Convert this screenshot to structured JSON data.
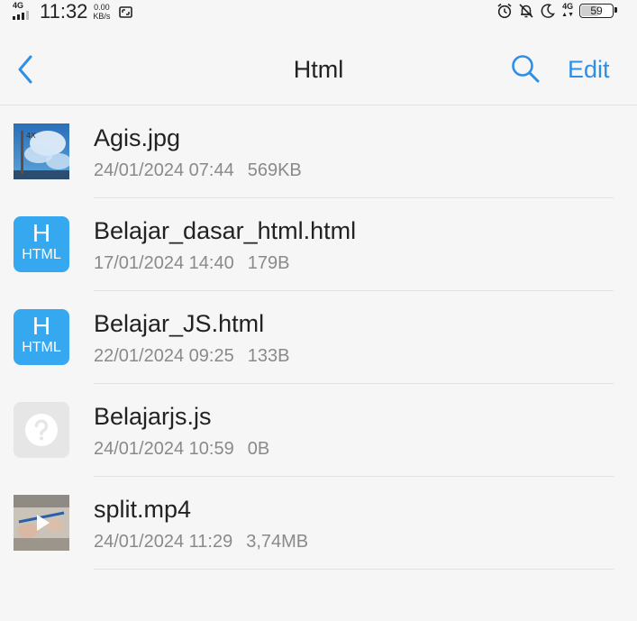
{
  "status_bar": {
    "network": "4G",
    "time": "11:32",
    "speed_value": "0.00",
    "speed_unit": "KB/s",
    "network2": "4G",
    "battery": "59",
    "battery_level": 0.59
  },
  "header": {
    "title": "Html",
    "edit_label": "Edit",
    "back_icon": "chevron-left-icon",
    "search_icon": "search-icon"
  },
  "files": [
    {
      "name": "Agis.jpg",
      "date": "24/01/2024 07:44",
      "size": "569KB",
      "icon": "image-thumbnail"
    },
    {
      "name": "Belajar_dasar_html.html",
      "date": "17/01/2024 14:40",
      "size": "179B",
      "icon": "html-file-icon",
      "icon_letter": "H",
      "icon_label": "HTML"
    },
    {
      "name": "Belajar_JS.html",
      "date": "22/01/2024 09:25",
      "size": "133B",
      "icon": "html-file-icon",
      "icon_letter": "H",
      "icon_label": "HTML"
    },
    {
      "name": "Belajarjs.js",
      "date": "24/01/2024 10:59",
      "size": "0B",
      "icon": "unknown-file-icon"
    },
    {
      "name": "split.mp4",
      "date": "24/01/2024 11:29",
      "size": "3,74MB",
      "icon": "video-thumbnail"
    }
  ],
  "colors": {
    "accent": "#2f8fe6",
    "html_icon": "#36a8ef",
    "background": "#f6f6f6",
    "secondary_text": "#8a8a8a"
  }
}
